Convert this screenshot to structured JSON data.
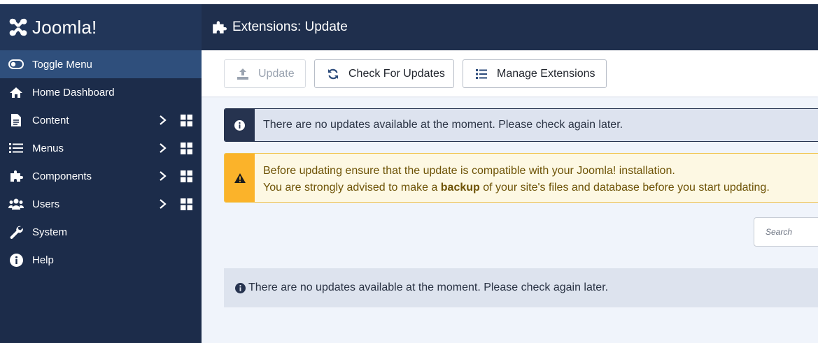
{
  "brand": {
    "name": "Joomla!"
  },
  "sidebar": {
    "items": [
      {
        "label": "Toggle Menu",
        "icon": "toggle-icon"
      },
      {
        "label": "Home Dashboard",
        "icon": "home-icon"
      },
      {
        "label": "Content",
        "icon": "file-icon"
      },
      {
        "label": "Menus",
        "icon": "list-icon"
      },
      {
        "label": "Components",
        "icon": "puzzle-icon"
      },
      {
        "label": "Users",
        "icon": "users-icon"
      },
      {
        "label": "System",
        "icon": "wrench-icon"
      },
      {
        "label": "Help",
        "icon": "info-icon"
      }
    ]
  },
  "header": {
    "title": "Extensions: Update"
  },
  "toolbar": {
    "update_label": "Update",
    "check_label": "Check For Updates",
    "manage_label": "Manage Extensions"
  },
  "alerts": {
    "info_text": "There are no updates available at the moment. Please check again later.",
    "warn_line1": "Before updating ensure that the update is compatible with your Joomla! installation.",
    "warn_line2_pre": "You are strongly advised to make a ",
    "warn_line2_bold": "backup",
    "warn_line2_post": " of your site's files and database before you start updating."
  },
  "search": {
    "placeholder": "Search"
  },
  "results": {
    "empty_text": "There are no updates available at the moment. Please check again later."
  },
  "colors": {
    "sidebar_bg": "#1c2c4a",
    "header_bg": "#1f2f4d",
    "toggle_bg": "#2f4f7c",
    "warning": "#fbb32a"
  }
}
